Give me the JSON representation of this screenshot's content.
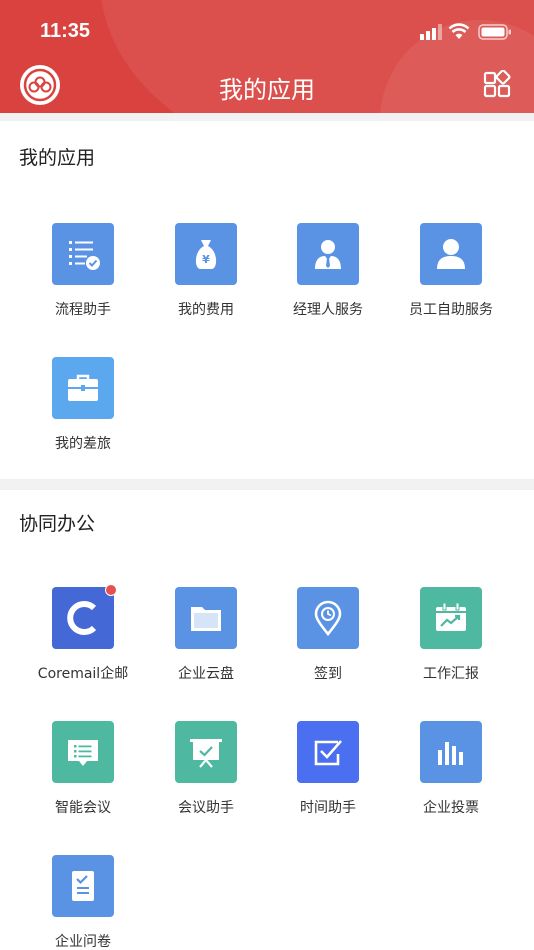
{
  "status_bar": {
    "time": "11:35"
  },
  "header": {
    "title": "我的应用"
  },
  "colors": {
    "header": "#d9423f",
    "blue": "#5b93e4",
    "teal": "#4fb8a0",
    "coremail": "#4468d6",
    "badge": "#e8504e"
  },
  "sections": [
    {
      "title": "我的应用",
      "apps": [
        {
          "label": "流程助手",
          "icon": "checklist-icon"
        },
        {
          "label": "我的费用",
          "icon": "money-bag-icon"
        },
        {
          "label": "经理人服务",
          "icon": "manager-icon"
        },
        {
          "label": "员工自助服务",
          "icon": "employee-icon"
        },
        {
          "label": "我的差旅",
          "icon": "briefcase-icon"
        }
      ]
    },
    {
      "title": "协同办公",
      "apps": [
        {
          "label": "Coremail企邮",
          "icon": "coremail-icon",
          "badge": true
        },
        {
          "label": "企业云盘",
          "icon": "folder-icon"
        },
        {
          "label": "签到",
          "icon": "location-pin-icon"
        },
        {
          "label": "工作汇报",
          "icon": "calendar-chart-icon"
        },
        {
          "label": "智能会议",
          "icon": "chat-bubble-icon"
        },
        {
          "label": "会议助手",
          "icon": "presentation-board-icon"
        },
        {
          "label": "时间助手",
          "icon": "checkbox-icon"
        },
        {
          "label": "企业投票",
          "icon": "bar-chart-icon"
        },
        {
          "label": "企业问卷",
          "icon": "document-check-icon"
        }
      ]
    }
  ]
}
